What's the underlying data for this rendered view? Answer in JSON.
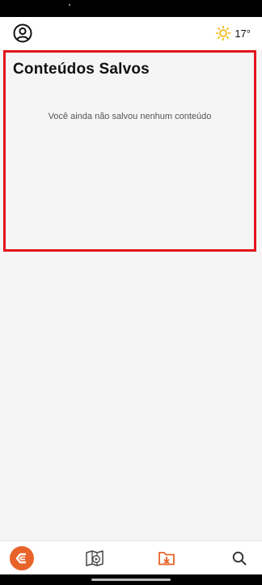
{
  "header": {
    "profile_icon": "user-circle-icon",
    "weather_icon": "sun-icon",
    "temperature": "17°"
  },
  "main": {
    "title": "Conteúdos Salvos",
    "empty_message": "Você ainda não salvou nenhum conteúdo"
  },
  "bottom_nav": {
    "items": [
      {
        "icon": "app-logo-icon",
        "active": false
      },
      {
        "icon": "book-play-icon",
        "active": false
      },
      {
        "icon": "download-folder-icon",
        "active": true
      },
      {
        "icon": "search-icon",
        "active": false
      }
    ]
  },
  "colors": {
    "accent": "#e8632a",
    "highlight_border": "#e2131b",
    "weather_sun": "#f0b400"
  }
}
